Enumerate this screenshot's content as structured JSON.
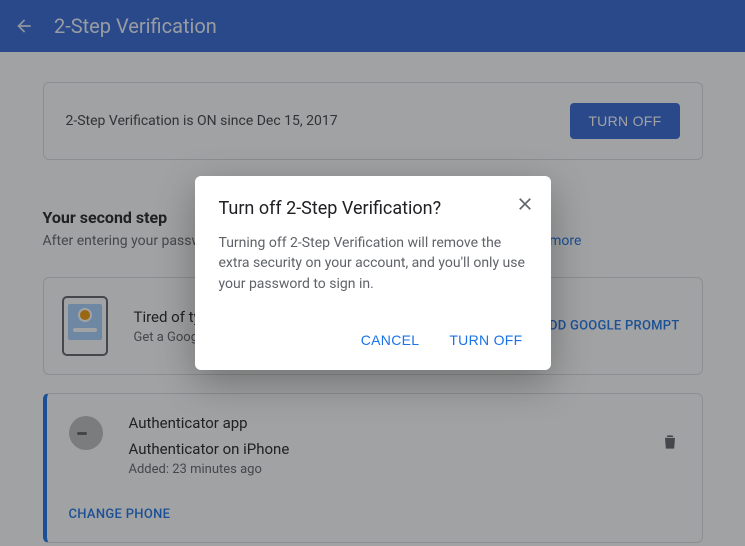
{
  "header": {
    "title": "2-Step Verification"
  },
  "status": {
    "text": "2-Step Verification is ON since Dec 15, 2017",
    "turn_off_label": "TURN OFF"
  },
  "second_step": {
    "heading": "Your second step",
    "subtext": "After entering your password, you'll be asked for a second verification step. ",
    "learn_more": "Learn more"
  },
  "promo": {
    "title": "Tired of typing verification codes?",
    "subtext": "Get a Google prompt on your phone and just tap Yes to sign in.",
    "cta": "ADD GOOGLE PROMPT"
  },
  "method": {
    "name_label": "Authenticator app",
    "device_label": "Authenticator on iPhone",
    "added_label": "Added: 23 minutes ago",
    "change_phone_label": "CHANGE PHONE"
  },
  "dialog": {
    "title": "Turn off 2-Step Verification?",
    "body": "Turning off 2-Step Verification will remove the extra security on your account, and you'll only use your password to sign in.",
    "cancel_label": "CANCEL",
    "confirm_label": "TURN OFF"
  }
}
